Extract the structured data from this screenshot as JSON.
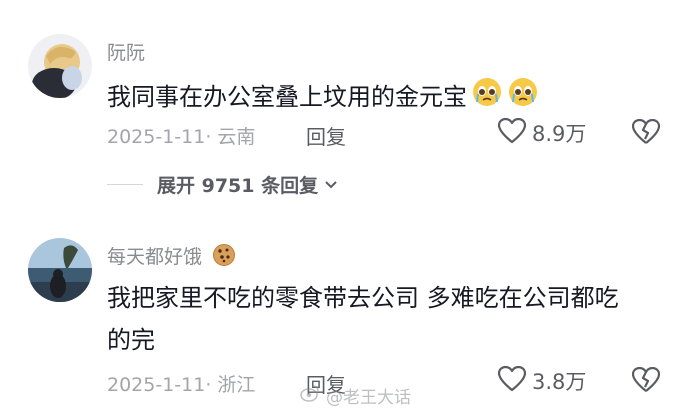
{
  "comments": [
    {
      "username": "阮阮",
      "text": "我同事在办公室叠上坟用的金元宝",
      "date_location": "2025-1-11· 云南",
      "reply_label": "回复",
      "likes": "8.9万",
      "emojis": [
        "pleading-face",
        "pleading-face"
      ],
      "expand_label": "展开 9751 条回复"
    },
    {
      "username": "每天都好饿",
      "username_emoji": "cookie",
      "text_line1": "我把家里不吃的零食带去公司 多难吃在公司都吃",
      "text_line2": "的完",
      "date_location": "2025-1-11· 浙江",
      "reply_label": "回复",
      "likes": "3.8万"
    }
  ],
  "watermark": "@老王大话",
  "colors": {
    "primary_text": "#161823",
    "secondary_text": "#8a8b91",
    "meta_text": "#a4a5aa",
    "icon": "#5b5c63"
  }
}
